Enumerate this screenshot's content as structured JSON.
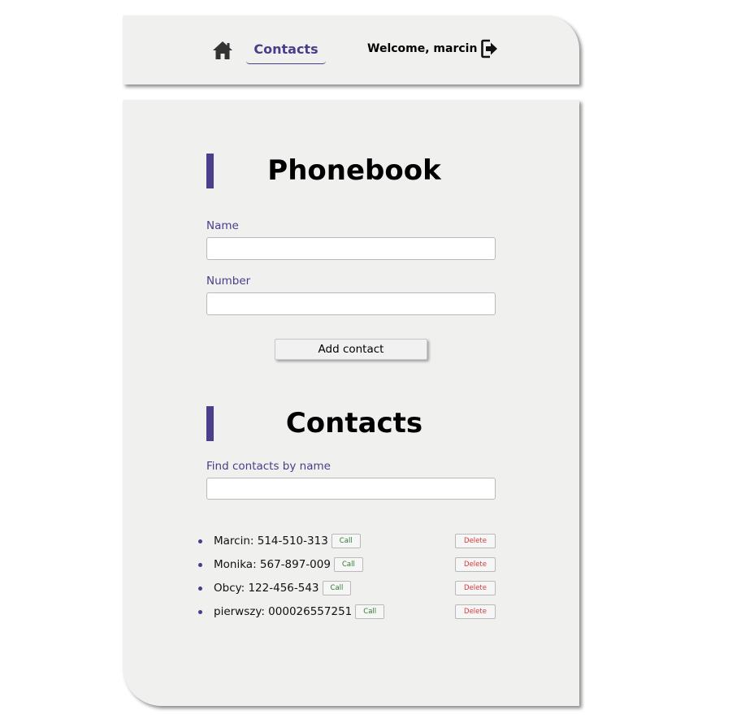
{
  "header": {
    "home_icon": "home-icon",
    "nav_contacts_label": "Contacts",
    "welcome_text": "Welcome, marcin",
    "logout_icon": "logout-icon"
  },
  "phonebook": {
    "title": "Phonebook",
    "name_label": "Name",
    "name_value": "",
    "number_label": "Number",
    "number_value": "",
    "add_button_label": "Add contact"
  },
  "contacts": {
    "title": "Contacts",
    "filter_label": "Find contacts by name",
    "filter_value": "",
    "call_label": "Call",
    "delete_label": "Delete",
    "items": [
      {
        "text": "Marcin: 514-510-313"
      },
      {
        "text": "Monika: 567-897-009"
      },
      {
        "text": "Obcy: 122-456-543"
      },
      {
        "text": "pierwszy: 000026557251"
      }
    ]
  },
  "colors": {
    "accent": "#483d8b",
    "panel_bg": "#f0f0ef",
    "call_text": "#2d7a2d",
    "delete_text": "#d23a3a"
  }
}
